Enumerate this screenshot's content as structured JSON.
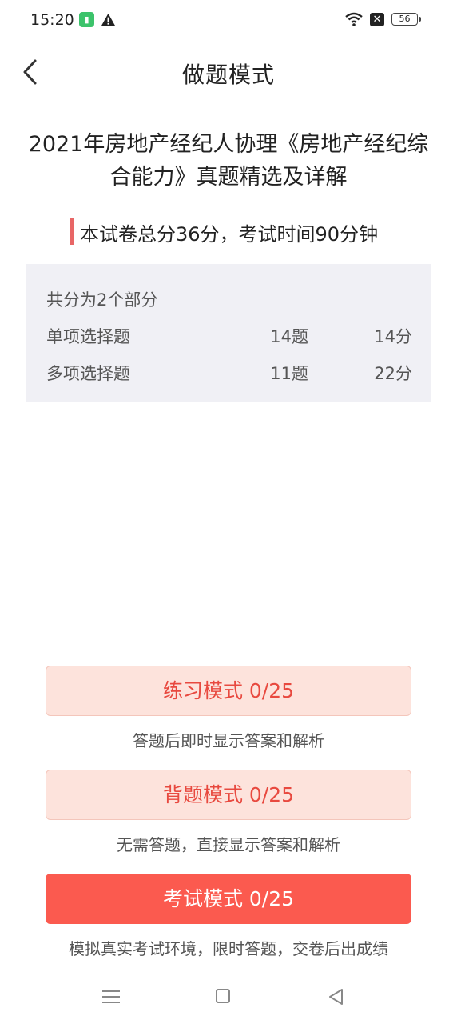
{
  "status_bar": {
    "time": "15:20",
    "battery": "56",
    "icons": [
      "app-icon",
      "warning-icon",
      "wifi-icon",
      "close-box-icon",
      "battery-icon"
    ]
  },
  "nav": {
    "back_icon": "chevron-left-icon",
    "title": "做题模式"
  },
  "exam": {
    "title": "2021年房地产经纪人协理《房地产经纪综合能力》真题精选及详解",
    "score_info": "本试卷总分36分，考试时间90分钟"
  },
  "sections": {
    "header": "共分为2个部分",
    "rows": [
      {
        "name": "单项选择题",
        "count": "14题",
        "points": "14分"
      },
      {
        "name": "多项选择题",
        "count": "11题",
        "points": "22分"
      }
    ]
  },
  "modes": [
    {
      "label": "练习模式  0/25",
      "desc": "答题后即时显示答案和解析"
    },
    {
      "label": "背题模式  0/25",
      "desc": "无需答题，直接显示答案和解析"
    },
    {
      "label": "考试模式  0/25",
      "desc": "模拟真实考试环境，限时答题，交卷后出成绩"
    }
  ],
  "colors": {
    "accent": "#fb5a4f",
    "light_button": "#fde3dc",
    "accent_text": "#e8493f",
    "score_bar": "#e86666",
    "sections_bg": "#f0f0f5"
  },
  "system_nav": [
    "menu-icon",
    "home-icon",
    "back-triangle-icon"
  ]
}
